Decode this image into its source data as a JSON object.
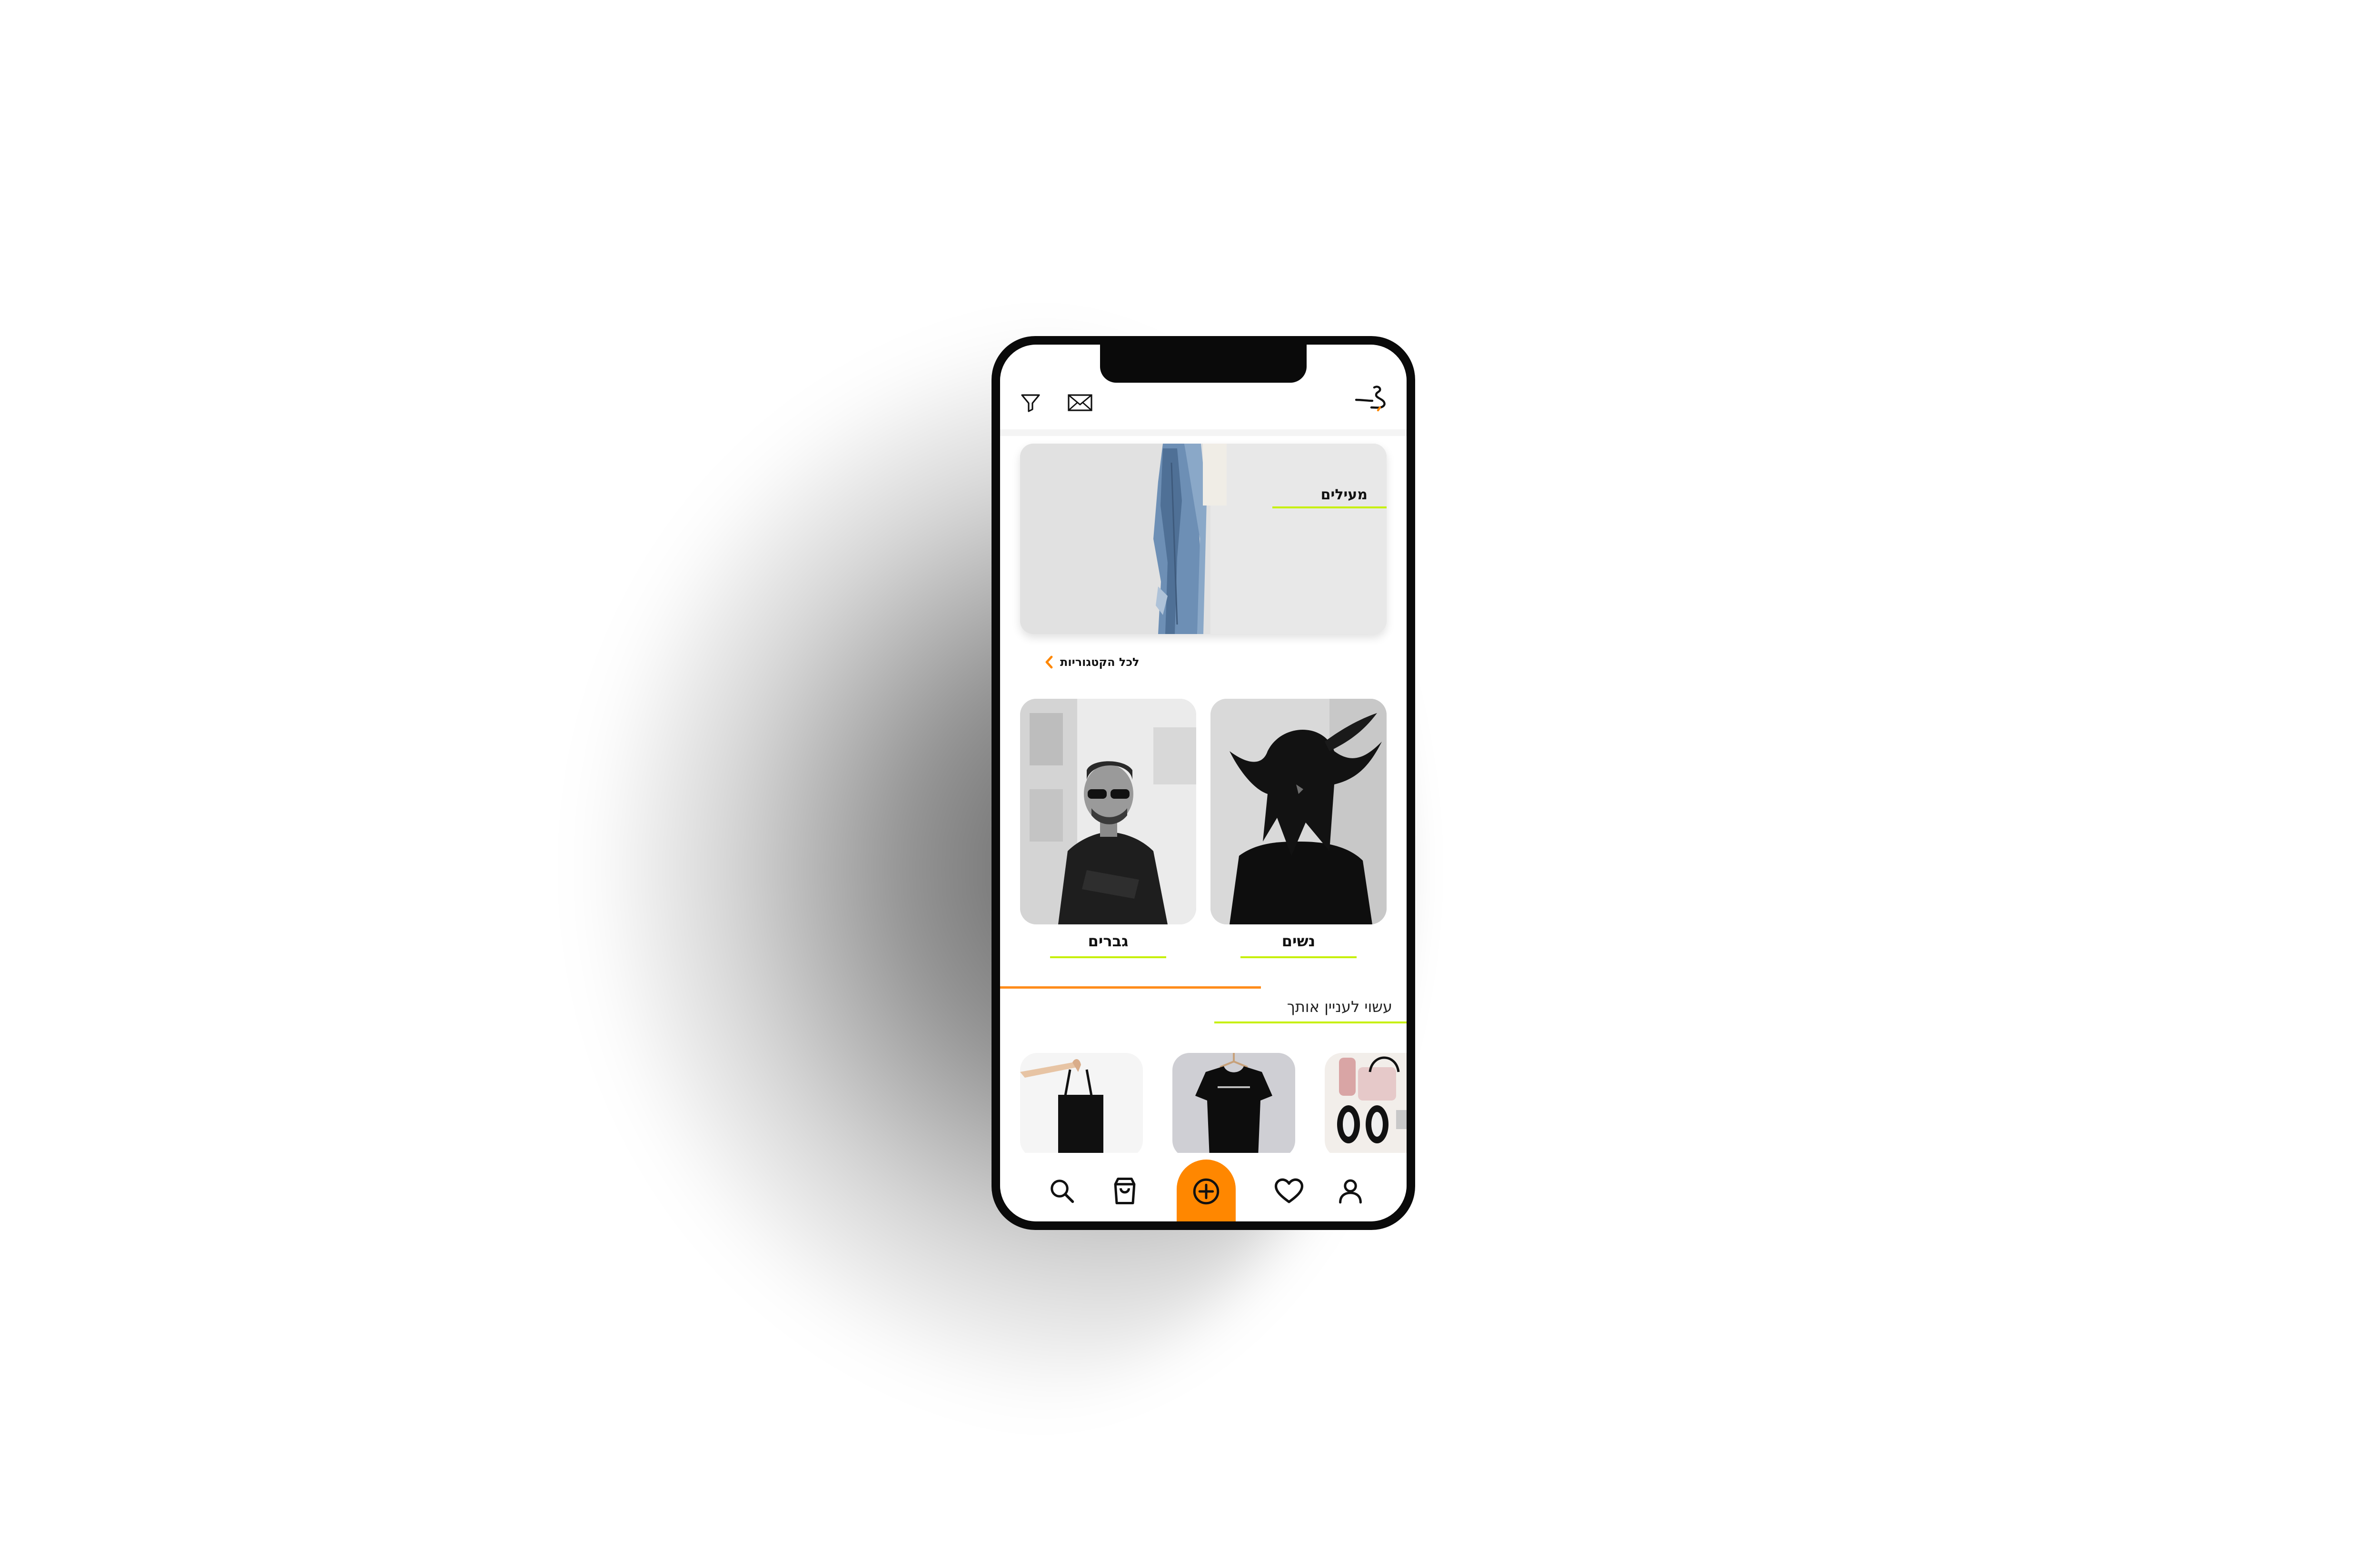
{
  "app": {
    "accent_color": "#ff8700",
    "highlight_color": "#c6f000",
    "logo_icon": "hanger-logo-icon"
  },
  "topbar": {
    "icons": [
      "filter-icon",
      "mail-icon"
    ]
  },
  "banner": {
    "title": "מעילים",
    "image": "denim-jacket-on-wall"
  },
  "all_categories": {
    "label": "לכל הקטגוריות",
    "icon": "chevron-left-icon"
  },
  "categories": [
    {
      "label": "נשים",
      "image": "woman-black-and-white-photo"
    },
    {
      "label": "גברים",
      "image": "man-in-sunglasses-photo"
    }
  ],
  "recommendations": {
    "title": "עשוי לעניין אותך",
    "items": [
      {
        "image": "black-tote-bag"
      },
      {
        "image": "black-tshirt-on-hanger"
      },
      {
        "image": "fashion-flatlay-accessories"
      }
    ]
  },
  "bottom_nav": {
    "items": [
      "search-icon",
      "shopping-bag-icon",
      "add-circle-icon",
      "heart-icon",
      "user-icon"
    ]
  }
}
